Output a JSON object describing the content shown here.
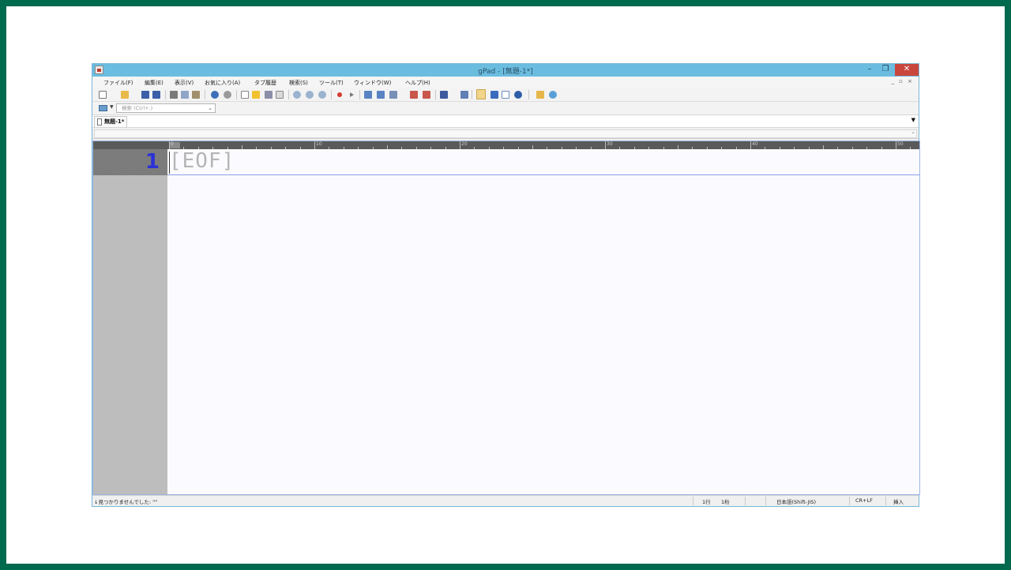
{
  "window": {
    "title": "gPad - [無題-1*]",
    "minimize": "–",
    "maximize": "❐",
    "close": "✕"
  },
  "menu": {
    "items": [
      "ファイル(F)",
      "編集(E)",
      "表示(V)",
      "お気に入り(A)",
      "タブ履歴",
      "検索(S)",
      "ツール(T)",
      "ウィンドウ(W)",
      "ヘルプ(H)"
    ],
    "mdi_controls": "_ ▫ ×"
  },
  "search": {
    "placeholder": "検索 (Ctrl+.)"
  },
  "tabs": {
    "active_label": "無題-1*",
    "dropdown": "▼"
  },
  "ruler": {
    "labels": [
      "0",
      "10",
      "20",
      "30",
      "40",
      "50"
    ]
  },
  "editor": {
    "line_number": "1",
    "eof_marker": "[EOF]"
  },
  "status": {
    "message": "↓見つかりませんでした: \"\"",
    "line": "1行",
    "column": "1桁",
    "encoding": "日本語(Shift-JIS)",
    "newline": "CR+LF",
    "mode": "挿入"
  },
  "colors": {
    "titlebar": "#6bbde0",
    "close_button": "#c9463d",
    "line_number": "#2b32d8",
    "gutter": "#bdbdbd",
    "frame": "#006a4e"
  },
  "toolbar_icons": [
    "new-file-icon",
    "open-folder-icon",
    "save-icon",
    "save-all-icon",
    "cut-icon",
    "copy-icon",
    "paste-icon",
    "undo-icon",
    "redo-icon",
    "folder-icon",
    "favorite-star-icon",
    "print-icon",
    "page-icon",
    "find-icon",
    "find-next-icon",
    "find-prev-icon",
    "record-icon",
    "play-icon",
    "grid-icon",
    "grid2-icon",
    "layout-icon",
    "split-h-icon",
    "split-v-icon",
    "window-icon",
    "window2-icon",
    "check-icon",
    "pen-icon",
    "frame-icon",
    "info-icon",
    "folder-open-icon",
    "globe-icon"
  ]
}
